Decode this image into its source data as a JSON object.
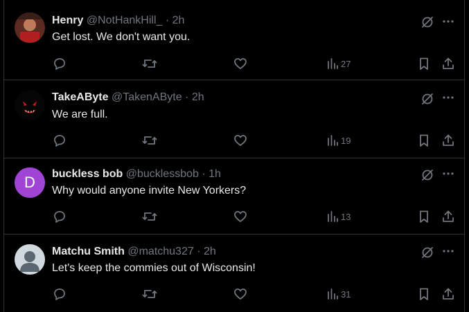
{
  "tweets": [
    {
      "name": "Henry",
      "handle": "@NotHankHill_",
      "separator": "·",
      "time": "2h",
      "text": "Get lost. We don't want you.",
      "views": "27",
      "avatar_type": "photo"
    },
    {
      "name": "TakeAByte",
      "handle": "@TakenAByte",
      "separator": "·",
      "time": "2h",
      "text": "We are full.",
      "views": "19",
      "avatar_type": "dark-mask"
    },
    {
      "name": "buckless bob",
      "handle": "@bucklessbob",
      "separator": "·",
      "time": "1h",
      "text": "Why would anyone invite New Yorkers?",
      "views": "13",
      "avatar_type": "letter",
      "avatar_letter": "D",
      "avatar_color": "#a044d6"
    },
    {
      "name": "Matchu Smith",
      "handle": "@matchu327",
      "separator": "·",
      "time": "2h",
      "text": "Let's keep the commies out of Wisconsin!",
      "views": "31",
      "avatar_type": "default"
    }
  ],
  "icons": {
    "reply": "reply-icon",
    "repost": "repost-icon",
    "like": "heart-icon",
    "views": "views-icon",
    "bookmark": "bookmark-icon",
    "share": "share-icon",
    "grok": "grok-icon",
    "more": "more-icon"
  },
  "colors": {
    "background": "#000000",
    "text": "#e7e9ea",
    "muted": "#71767b",
    "divider": "#2f3336"
  }
}
